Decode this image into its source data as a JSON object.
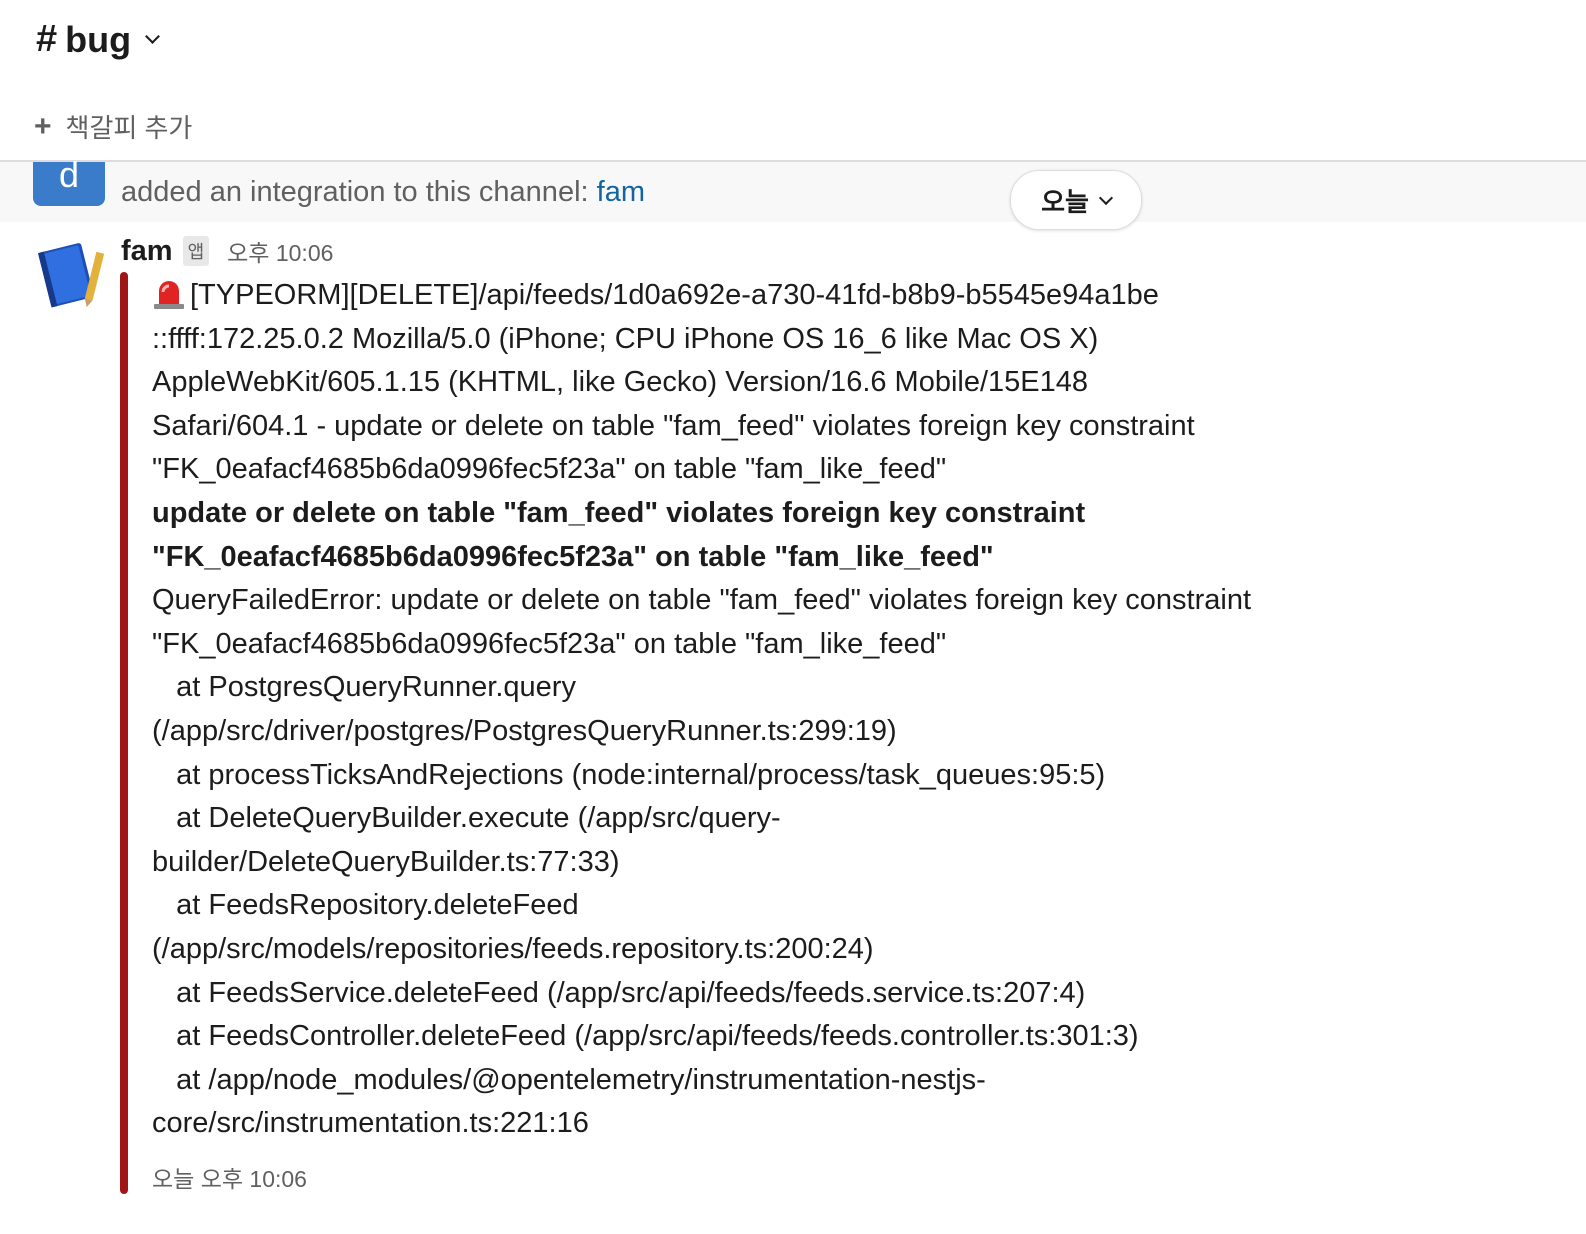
{
  "header": {
    "hash": "#",
    "channel_name": "bug",
    "bookmark_plus": "+",
    "bookmark_label": "책갈피 추가"
  },
  "previous_message": {
    "avatar_letter": "d",
    "text": "added an integration to this channel: ",
    "link": "fam"
  },
  "date_divider": {
    "label": "오늘"
  },
  "message": {
    "sender": "fam",
    "badge": "앱",
    "time": "오후 10:06",
    "lines": [
      "[TYPEORM][DELETE]/api/feeds/1d0a692e-a730-41fd-b8b9-b5545e94a1be",
      "::ffff:172.25.0.2 Mozilla/5.0 (iPhone; CPU iPhone OS 16_6 like Mac OS X)",
      "AppleWebKit/605.1.15 (KHTML, like Gecko) Version/16.6 Mobile/15E148",
      "Safari/604.1 - update or delete on table \"fam_feed\" violates foreign key constraint",
      "\"FK_0eafacf4685b6da0996fec5f23a\" on table \"fam_like_feed\"",
      "update or delete on table \"fam_feed\" violates foreign key constraint",
      "\"FK_0eafacf4685b6da0996fec5f23a\" on table \"fam_like_feed\"",
      "QueryFailedError: update or delete on table \"fam_feed\" violates foreign key constraint",
      "\"FK_0eafacf4685b6da0996fec5f23a\" on table \"fam_like_feed\"",
      "   at PostgresQueryRunner.query",
      "(/app/src/driver/postgres/PostgresQueryRunner.ts:299:19)",
      "   at processTicksAndRejections (node:internal/process/task_queues:95:5)",
      "   at DeleteQueryBuilder.execute (/app/src/query-",
      "builder/DeleteQueryBuilder.ts:77:33)",
      "   at FeedsRepository.deleteFeed",
      "(/app/src/models/repositories/feeds.repository.ts:200:24)",
      "   at FeedsService.deleteFeed (/app/src/api/feeds/feeds.service.ts:207:4)",
      "   at FeedsController.deleteFeed (/app/src/api/feeds/feeds.controller.ts:301:3)",
      "   at /app/node_modules/@opentelemetry/instrumentation-nestjs-",
      "core/src/instrumentation.ts:221:16"
    ],
    "footer": "오늘 오후 10:06",
    "accent_color": "#a01616"
  },
  "colors": {
    "link": "#1264a3",
    "muted": "#616061",
    "avatar_blue": "#3a7cc9"
  },
  "icons": {
    "siren": "siren-emoji",
    "app_avatar": "notebook-pencil-icon"
  }
}
